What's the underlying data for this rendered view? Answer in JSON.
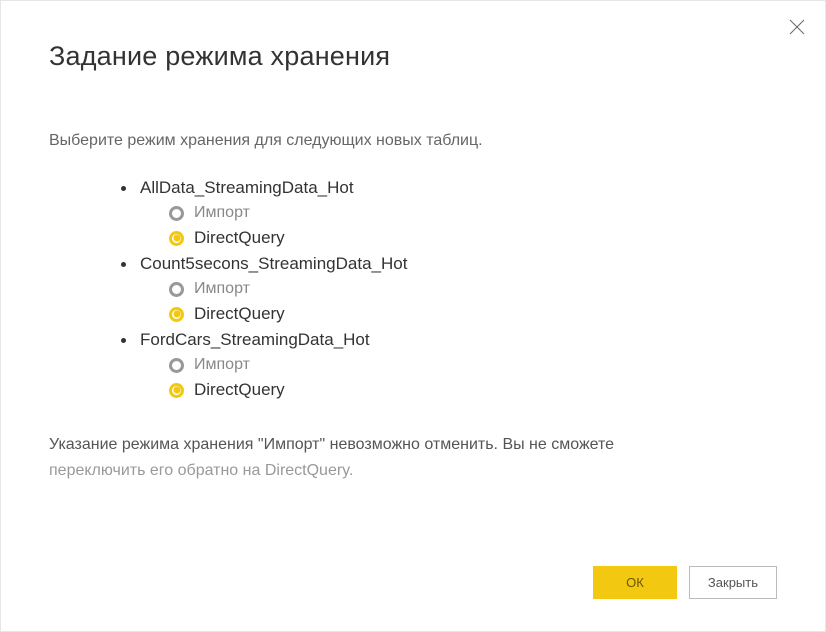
{
  "title": "Задание режима хранения",
  "subtitle": "Выберите режим хранения для следующих новых таблиц.",
  "tables": [
    {
      "name": "AllData_StreamingData_Hot",
      "import_label": "Импорт",
      "dq_label": "DirectQuery"
    },
    {
      "name": "Count5secons_StreamingData_Hot",
      "import_label": "Импорт",
      "dq_label": "DirectQuery"
    },
    {
      "name": "FordCars_StreamingData_Hot",
      "import_label": "Импорт",
      "dq_label": "DirectQuery"
    }
  ],
  "warning_line1": "Указание режима хранения \"Импорт\" невозможно отменить. Вы не сможете",
  "warning_line2": "переключить его обратно на DirectQuery.",
  "buttons": {
    "ok": "ОК",
    "close": "Закрыть"
  }
}
